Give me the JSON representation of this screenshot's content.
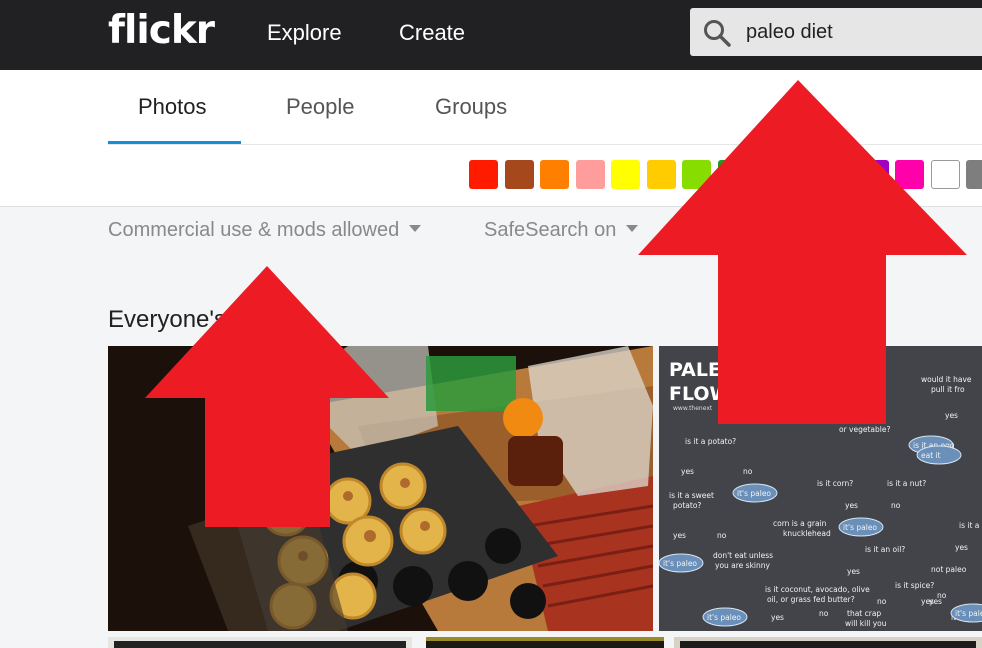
{
  "header": {
    "logo": "flickr",
    "nav": [
      "Explore",
      "Create"
    ],
    "search": {
      "value": "paleo diet"
    }
  },
  "tabs": [
    "Photos",
    "People",
    "Groups"
  ],
  "active_tab": "Photos",
  "colors": {
    "swatches": [
      "#fe1b00",
      "#a5481b",
      "#ff7f00",
      "#ff9d9d",
      "#ffff00",
      "#ffcc00",
      "#88dd00",
      "#1d9d1d",
      "#1dc7c7",
      "#1d82d8",
      "#271bc1",
      "#a000c2",
      "#ff00aa",
      "#ffffff",
      "#7e7e7e",
      "#000000"
    ],
    "accent": "#128fdc",
    "arrow": "#ed1c24"
  },
  "filters": [
    "Commercial use & mods allowed",
    "SafeSearch on"
  ],
  "section": {
    "title": "Everyone's photos"
  },
  "photos": [
    {
      "label": "muffins-photo"
    },
    {
      "label": "flowchart-photo",
      "chalkboard": {
        "title_lines": [
          "PALEO",
          "FLOWC"
        ],
        "site": "www.thenext",
        "nodes": [
          "would it have",
          "pull it fro",
          "or vegetable?",
          "is it a potato?",
          "yes",
          "no",
          "is it an egg",
          "eat it",
          "yes",
          "it's paleo",
          "is it a sweet",
          "potato?",
          "is it corn?",
          "is it a nut?",
          "no",
          "yes",
          "corn is a grain",
          "knucklehead",
          "it's paleo",
          "yes",
          "no",
          "don't eat unless",
          "you are skinny",
          "is it an oil?",
          "it's paleo",
          "yes",
          "is it a pe",
          "yes",
          "not paleo",
          "is it coconut, avocado, olive",
          "oil, or grass fed butter?",
          "is it spice?",
          "no",
          "yes",
          "it's paleo",
          "yes",
          "no",
          "that crap",
          "will kill you",
          "it's paleo",
          "yes",
          "no",
          "it's paleo"
        ]
      }
    }
  ]
}
